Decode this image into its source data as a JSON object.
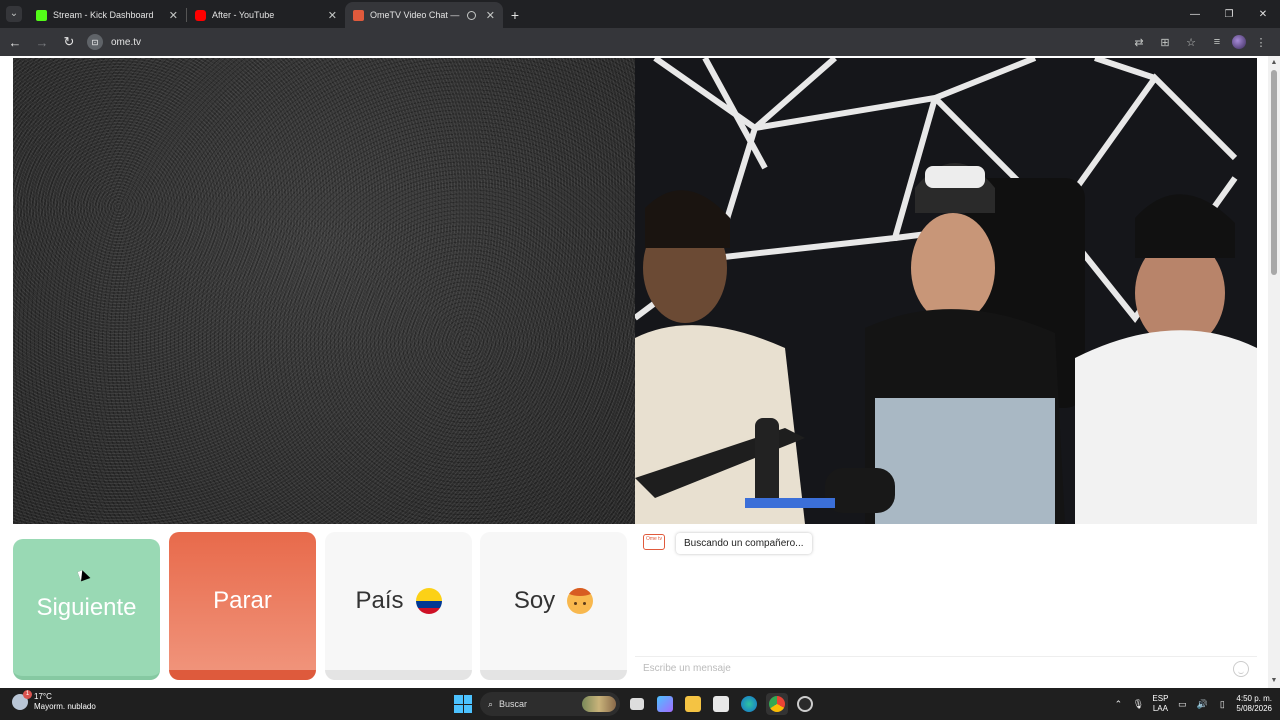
{
  "browser": {
    "tabs": [
      {
        "title": "Stream - Kick Dashboard",
        "favicon_color": "#53fc18",
        "active": false
      },
      {
        "title": "After - YouTube",
        "favicon_color": "#ff0000",
        "active": false
      },
      {
        "title": "OmeTV Video Chat — Ome",
        "favicon_color": "#e05a3c",
        "active": true
      }
    ],
    "new_tab_label": "+",
    "url": "ome.tv"
  },
  "buttons": {
    "next": "Siguiente",
    "stop": "Parar",
    "country": "País",
    "gender": "Soy"
  },
  "chat": {
    "logo_text": "Ome tv",
    "status_message": "Buscando un compañero...",
    "input_placeholder": "Escribe un mensaje"
  },
  "taskbar": {
    "weather_temp": "17°C",
    "weather_desc": "Mayorm. nublado",
    "search_label": "Buscar",
    "lang_top": "ESP",
    "lang_bottom": "LAA",
    "time": "4:50 p. m.",
    "date": "5/08/2026"
  },
  "colors": {
    "next_button": "#99d9b4",
    "stop_button": "#e86a4b",
    "brand": "#e05a3c"
  }
}
